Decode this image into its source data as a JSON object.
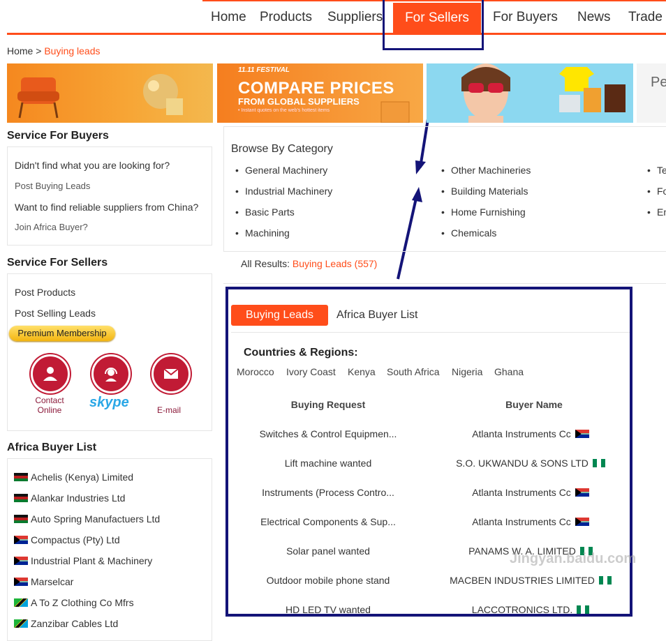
{
  "nav": {
    "items": [
      "Home",
      "Products",
      "Suppliers",
      "For Sellers",
      "For Buyers",
      "News",
      "Trade"
    ],
    "active": "For Sellers"
  },
  "breadcrumb": {
    "home": "Home",
    "separator": ">",
    "current": "Buying leads"
  },
  "banners": {
    "compare_tag": "11.11 FESTIVAL",
    "compare_big": "COMPARE PRICES",
    "compare_small": "FROM GLOBAL SUPPLIERS",
    "compare_tiny": "• Instant quotes on the web's hottest items",
    "partial_text": "Pe"
  },
  "service_buyers": {
    "title": "Service For Buyers",
    "lines": [
      "Didn't find what you are looking for?",
      "Post Buying Leads",
      "Want to find reliable suppliers from China?",
      "Join Africa Buyer?"
    ]
  },
  "service_sellers": {
    "title": "Service For Sellers",
    "post_products": "Post Products",
    "post_selling": "Post Selling Leads",
    "premium": "Premium Membership",
    "contact_online": "Contact Online",
    "skype": "skype",
    "email": "E-mail"
  },
  "africa_buyer_list": {
    "title": "Africa Buyer List",
    "items": [
      {
        "name": "Achelis (Kenya) Limited",
        "flag": "kenya"
      },
      {
        "name": "Alankar Industries Ltd",
        "flag": "kenya"
      },
      {
        "name": "Auto Spring Manufactuers Ltd",
        "flag": "kenya"
      },
      {
        "name": "Compactus (Pty) Ltd",
        "flag": "south-africa"
      },
      {
        "name": "Industrial Plant & Machinery",
        "flag": "south-africa"
      },
      {
        "name": "Marselcar",
        "flag": "south-africa"
      },
      {
        "name": "A To Z Clothing Co Mfrs",
        "flag": "tanzania"
      },
      {
        "name": "Zanzibar Cables Ltd",
        "flag": "tanzania"
      }
    ]
  },
  "category": {
    "title": "Browse By Category",
    "col1": [
      "General Machinery",
      "Industrial Machinery",
      "Basic Parts",
      "Machining"
    ],
    "col2": [
      "Other Machineries",
      "Building Materials",
      "Home Furnishing",
      "Chemicals"
    ],
    "col3": [
      "Te",
      "Fo",
      "En"
    ]
  },
  "results": {
    "label": "All Results:",
    "value": "Buying Leads (557)"
  },
  "tabs": {
    "active": "Buying Leads",
    "other": "Africa Buyer List"
  },
  "countries": {
    "title": "Countries & Regions:",
    "items": [
      "Morocco",
      "Ivory Coast",
      "Kenya",
      "South Africa",
      "Nigeria",
      "Ghana"
    ]
  },
  "leads_table": {
    "headers": [
      "Buying Request",
      "Buyer Name"
    ],
    "rows": [
      {
        "request": "Switches & Control Equipmen...",
        "buyer": "Atlanta Instruments Cc",
        "flag": "south-africa"
      },
      {
        "request": "Lift machine wanted",
        "buyer": "S.O. UKWANDU & SONS LTD",
        "flag": "nigeria"
      },
      {
        "request": "Instruments (Process Contro...",
        "buyer": "Atlanta Instruments Cc",
        "flag": "south-africa"
      },
      {
        "request": "Electrical Components & Sup...",
        "buyer": "Atlanta Instruments Cc",
        "flag": "south-africa"
      },
      {
        "request": "Solar panel wanted",
        "buyer": "PANAMS W. A. LIMITED",
        "flag": "nigeria"
      },
      {
        "request": "Outdoor mobile phone stand",
        "buyer": "MACBEN INDUSTRIES LIMITED",
        "flag": "nigeria"
      },
      {
        "request": "HD LED TV wanted",
        "buyer": "LACCOTRONICS LTD.",
        "flag": "nigeria"
      }
    ]
  },
  "watermark": "Jingyan.baidu.com",
  "colors": {
    "accent": "#ff4d1a",
    "highlight": "#141478",
    "contact": "#c11b35"
  }
}
